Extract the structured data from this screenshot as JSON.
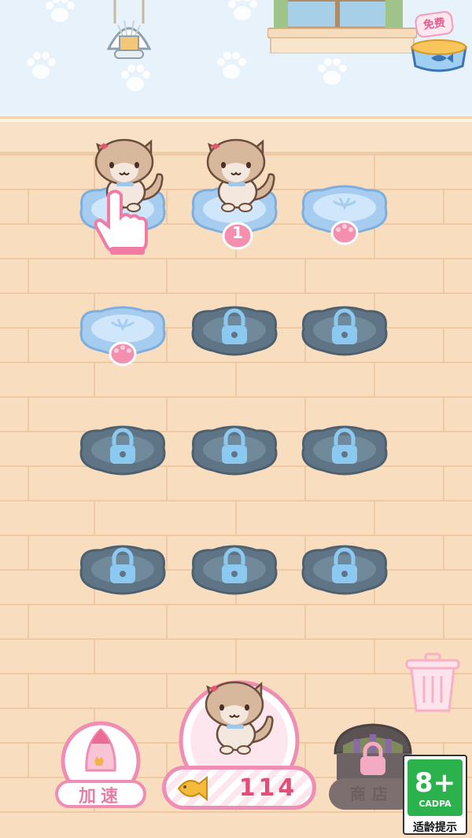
{
  "top_bar": {
    "free_label": "免费"
  },
  "grid": {
    "rows": [
      [
        "cat_bed",
        "cat_bed",
        "empty_bed"
      ],
      [
        "empty_bed",
        "locked",
        "locked"
      ],
      [
        "locked",
        "locked",
        "locked"
      ],
      [
        "locked",
        "locked",
        "locked"
      ]
    ],
    "slot_badge": "1"
  },
  "bottom_bar": {
    "boost_label": "加速",
    "fish_count": "114",
    "shop_label": "商店"
  },
  "age_rating": {
    "rating": "8+",
    "org": "CADPA",
    "tip": "适龄提示"
  },
  "colors": {
    "accent_pink": "#f08db4",
    "bed_blue": "#cfe8fa",
    "locked_gray": "#5f7586",
    "brick": "#f9ddbf",
    "rating_green": "#2bb24c"
  },
  "icons": {
    "lock": "lock-icon",
    "paw": "paw-icon",
    "fish": "fish-icon",
    "trash": "trash-can-icon",
    "hand": "pointing-hand-icon"
  }
}
